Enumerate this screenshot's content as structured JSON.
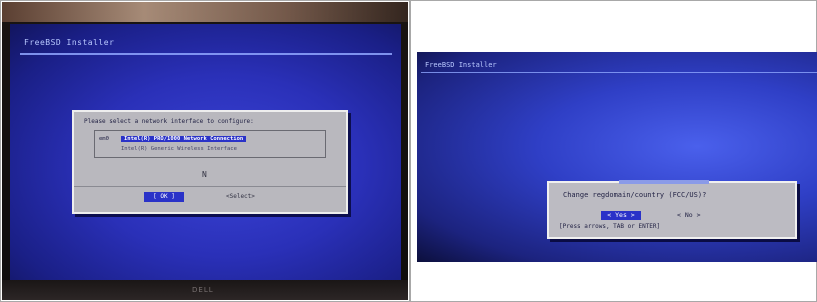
{
  "left_photo": {
    "installer_title": "FreeBSD Installer",
    "dialog": {
      "prompt": "Please select a network interface to configure:",
      "interfaces": [
        {
          "key": "em0",
          "description": "Intel(R) PRO/1000 Network Connection",
          "selected": true
        },
        {
          "key": "",
          "description": "Intel(R) Generic Wireless Interface",
          "selected": false
        }
      ],
      "cursor_char": "N",
      "ok_label": "[ OK ]",
      "select_label": "<Select>"
    },
    "bezel_brand": "DELL"
  },
  "right_photo": {
    "installer_title": "FreeBSD Installer",
    "dialog": {
      "question": "Change regdomain/country (FCC/US)?",
      "yes_label": "< Yes >",
      "no_label": "< No >",
      "hint": "[Press arrows, TAB or ENTER]"
    }
  },
  "colors": {
    "screen_blue": "#2a30b8",
    "dialog_gray": "#b9b8be",
    "selection_blue": "#2a32c8"
  }
}
